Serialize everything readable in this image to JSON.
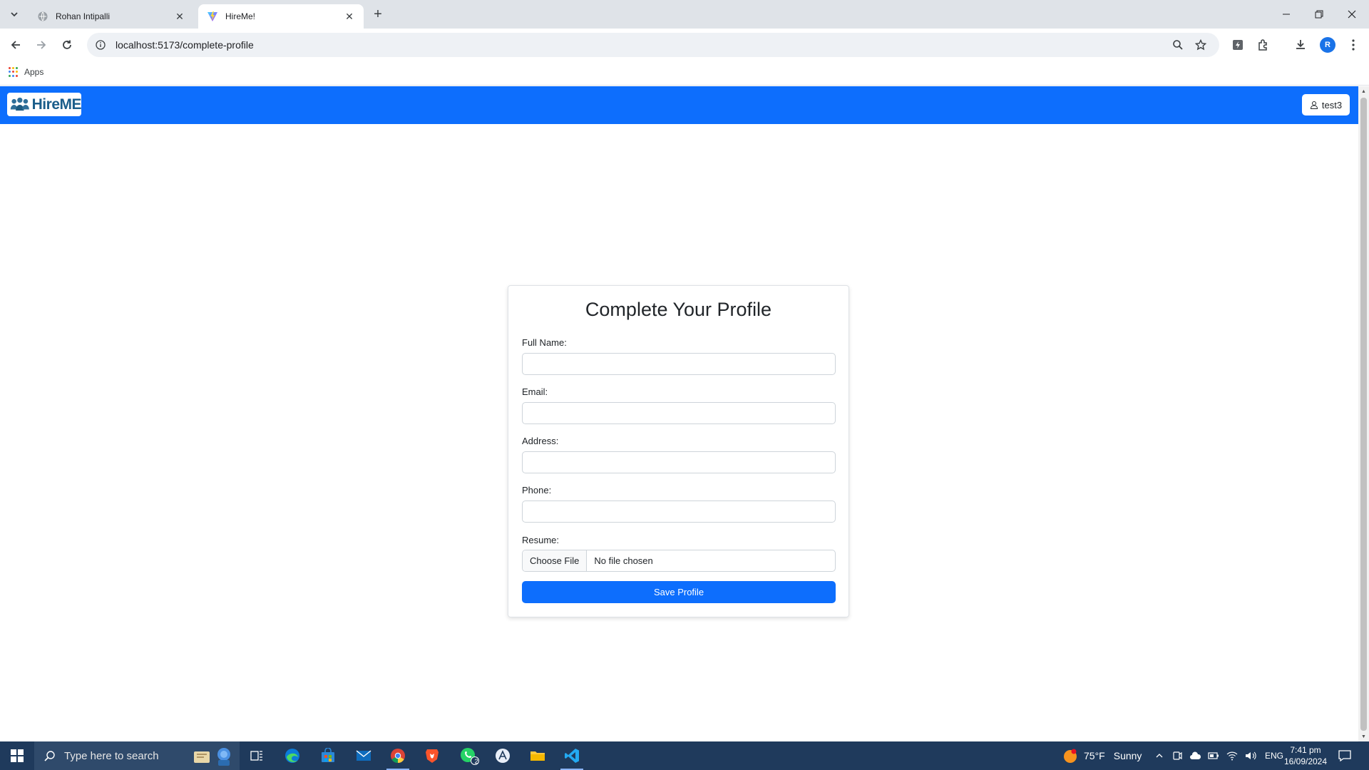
{
  "browser": {
    "tabs": [
      {
        "title": "Rohan Intipalli",
        "active": false
      },
      {
        "title": "HireMe!",
        "active": true
      }
    ],
    "url": "localhost:5173/complete-profile",
    "profile_initial": "R",
    "bookmarks": {
      "apps_label": "Apps"
    }
  },
  "app": {
    "brand_name": "HireME",
    "user_button_label": "test3",
    "nav_color": "#0d6efd"
  },
  "form": {
    "title": "Complete Your Profile",
    "fields": [
      {
        "label": "Full Name:",
        "value": ""
      },
      {
        "label": "Email:",
        "value": ""
      },
      {
        "label": "Address:",
        "value": ""
      },
      {
        "label": "Phone:",
        "value": ""
      }
    ],
    "resume": {
      "label": "Resume:",
      "choose_label": "Choose File",
      "status": "No file chosen"
    },
    "save_label": "Save Profile"
  },
  "taskbar": {
    "search_placeholder": "Type here to search",
    "weather": {
      "temp": "75°F",
      "condition": "Sunny"
    },
    "language": "ENG",
    "time": "7:41 pm",
    "date": "16/09/2024",
    "whatsapp_badge": "2"
  }
}
